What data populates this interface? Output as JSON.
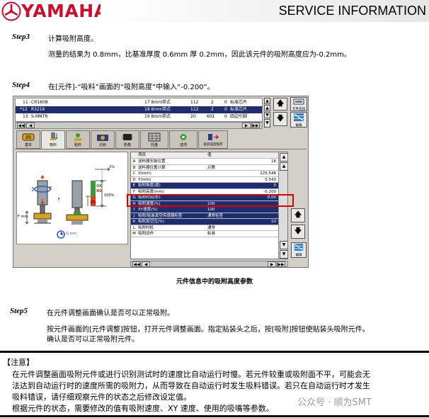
{
  "header": {
    "brand": "YAMAHA",
    "title": "SERVICE INFORMATION"
  },
  "step3": {
    "label": "Step3",
    "title": "计算吸附高度。",
    "body": "测量的结果为 0.8mm，比基准厚度 0.6mm 厚 0.2mm，因此该元件的吸附高度应为-0.2mm。"
  },
  "step4": {
    "label": "Step4",
    "title": "在[元件]-“吸料”画面的“吸附高度”中输入“-0.200”。"
  },
  "screen": {
    "top_list": [
      {
        "no": "11",
        "name": "CR1608",
        "feeder": "17 8mm带式",
        "a": "112",
        "b": "2",
        "c": "0",
        "type": "标准芯片"
      },
      {
        "no": "*12",
        "name": "R3216",
        "feeder": "18 8mm带式",
        "a": "112",
        "b": "2",
        "c": "0",
        "type": "标准芯片"
      },
      {
        "no": "13",
        "name": "S-MNTR",
        "feeder": "19 8mm带式",
        "a": "20",
        "b": "601",
        "c": "0",
        "type": "四边引脚"
      }
    ],
    "side_top_label": "元件追加",
    "side_edit_label": "编辑",
    "tabs": [
      "基本",
      "吸料",
      "贴料",
      "识别",
      "影像",
      "托盘",
      "选项",
      "贴装前后程序"
    ],
    "diagram": {
      "label_top": "1%",
      "ok": "OK",
      "ng": "NG",
      "pct": "100%",
      "e": "E",
      "k": "K%",
      "f": "F",
      "fmm": "F mm",
      "gauge": "G mm"
    },
    "grid_header": {
      "item": "项目",
      "value": "值"
    },
    "grid_rows": [
      {
        "key": "A",
        "item": "送料器安装位置",
        "value": "18",
        "align": "r",
        "style": ""
      },
      {
        "key": "B",
        "item": "送料器位置计算",
        "value": "示教",
        "align": "l",
        "style": ""
      },
      {
        "key": "C",
        "item": "X(mm)",
        "value": "225.546",
        "align": "r",
        "style": ""
      },
      {
        "key": "D",
        "item": "Y(mm)",
        "value": "5.543",
        "align": "r",
        "style": ""
      },
      {
        "key": "E",
        "item": "吸附角度(度)",
        "value": "0",
        "align": "r",
        "style": "blue"
      },
      {
        "key": "F",
        "item": "吸附高度(mm)",
        "value": "-0.200",
        "align": "r",
        "style": "sel"
      },
      {
        "key": "G",
        "item": "吸附时间(秒)",
        "value": "0.00",
        "align": "r",
        "style": "blue"
      },
      {
        "key": "H",
        "item": "吸附速度(%)",
        "value": "100",
        "align": "l",
        "style": "blue"
      },
      {
        "key": "I",
        "item": "XY速度(%)",
        "value": "100",
        "align": "l",
        "style": "blue"
      },
      {
        "key": "J",
        "item": "吸附/贴装真空传感器检查",
        "value": "通常检查",
        "align": "l",
        "style": "blue"
      },
      {
        "key": "K",
        "item": "吸附真空压(%)",
        "value": "10",
        "align": "r",
        "style": "blue"
      },
      {
        "key": "L",
        "item": "吸附时机",
        "value": "通常",
        "align": "l",
        "style": ""
      },
      {
        "key": "M",
        "item": "吸附动作",
        "value": "标准",
        "align": "l",
        "style": ""
      }
    ]
  },
  "caption": "元件信息中的吸附高度参数",
  "step5": {
    "label": "Step5",
    "title": "在元件调整画面确认是否可以正常吸附。",
    "line1": "按元件画面的[元件调整]按钮，打开元件调整画面。指定贴装头之后，按[吸附]按钮使贴装头吸附元件。",
    "line2": "确认是否可以正常吸附元件。"
  },
  "note": {
    "title": "【注意】",
    "lines": [
      "在元件调整画面吸附元件或进行识别测试时的速度比自动运行时慢。若元件较重或吸附面不平，可能会无",
      "法达到自动运行时的速度所需的吸附力，从而导致在自动运行时发生吸料错误。若只在自动运行时才发生",
      "吸料错误，请仔细观察元件的状态之后修改设定值。",
      "根据元件的状态，需要修改的值有吸附速度、XY 速度、使用的吸嘴等参数。"
    ]
  },
  "watermark": "公众号 · 顺为SMT",
  "colors": {
    "brand_red": "#c8102e",
    "selected_row": "#1e2d6e",
    "highlight_box": "#e00000"
  }
}
